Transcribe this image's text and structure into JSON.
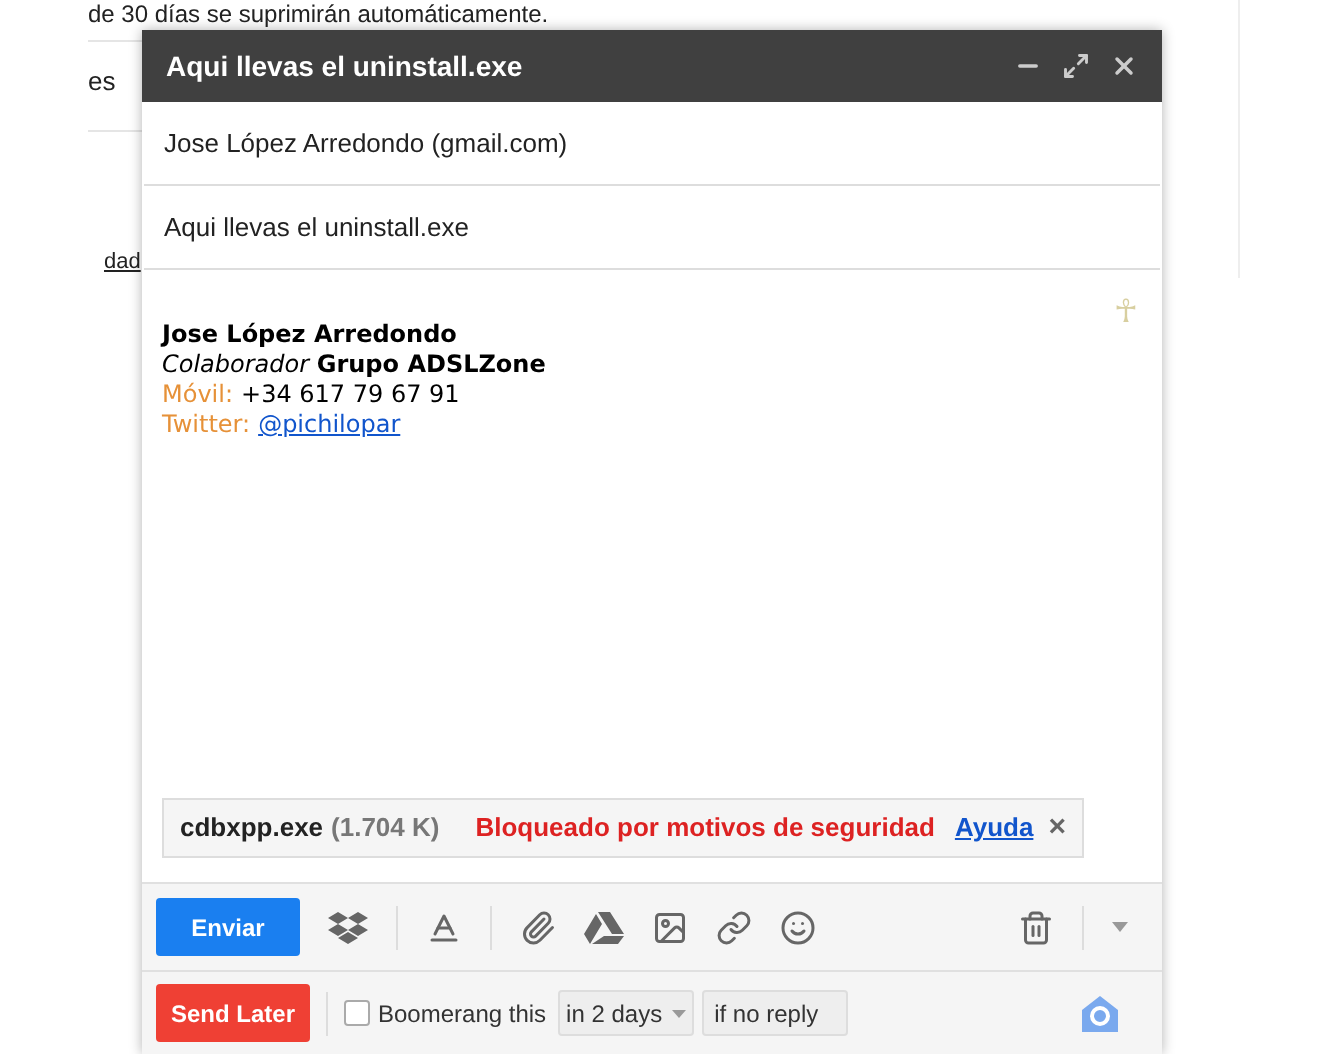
{
  "background": {
    "lines": [
      "de 30 días se suprimirán automáticamente.",
      "es",
      "dad"
    ]
  },
  "compose": {
    "corner_mark": "☥",
    "title": "Aqui llevas el uninstall.exe",
    "to": "Jose López Arredondo (gmail.com)",
    "subject": "Aqui llevas el uninstall.exe",
    "signature": {
      "name": "Jose López Arredondo",
      "role": "*Colaborador* **Grupo ADSLZone**",
      "phone_label": "Móvil:",
      "phone": "+34 617 79 67 91",
      "twitter_label": "Twitter:",
      "twitter": "@pichilopar"
    },
    "attachment": {
      "file": "cdbxpp.exe",
      "size": "(1.704 K)",
      "warning": "Bloqueado por motivos de seguridad",
      "help": "Ayuda",
      "close": "×"
    },
    "send_button": "Enviar",
    "boomerang": {
      "send_later": "Send Later",
      "label": "Boomerang this",
      "checked": false,
      "when": "in 2 days",
      "condition": "if no reply"
    }
  }
}
